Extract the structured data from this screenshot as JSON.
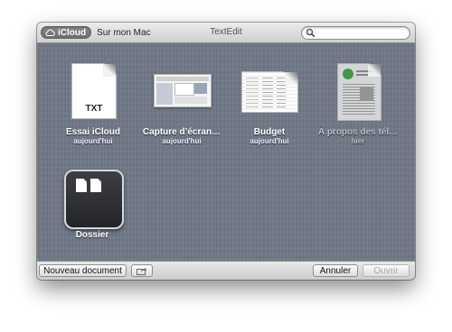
{
  "titlebar": {
    "icloud_label": "iCloud",
    "mac_label": "Sur mon Mac",
    "app_title": "TextEdit",
    "search_placeholder": ""
  },
  "documents": [
    {
      "name": "Essai iCloud",
      "date": "aujourd'hui",
      "icon": "txt-document-icon",
      "badge": "TXT"
    },
    {
      "name": "Capture d’écran…",
      "date": "aujourd'hui",
      "icon": "screenshot-thumbnail-icon"
    },
    {
      "name": "Budget",
      "date": "aujourd'hui",
      "icon": "spreadsheet-document-icon"
    },
    {
      "name": "À propos des tél…",
      "date": "hier",
      "icon": "pdf-document-icon"
    }
  ],
  "folder": {
    "name": "Dossier",
    "icon": "folder-icon"
  },
  "footer": {
    "new_document": "Nouveau document",
    "share_icon": "share-icon",
    "cancel": "Annuler",
    "open": "Ouvrir"
  },
  "colors": {
    "background": "#707887",
    "label": "#ffffff"
  }
}
